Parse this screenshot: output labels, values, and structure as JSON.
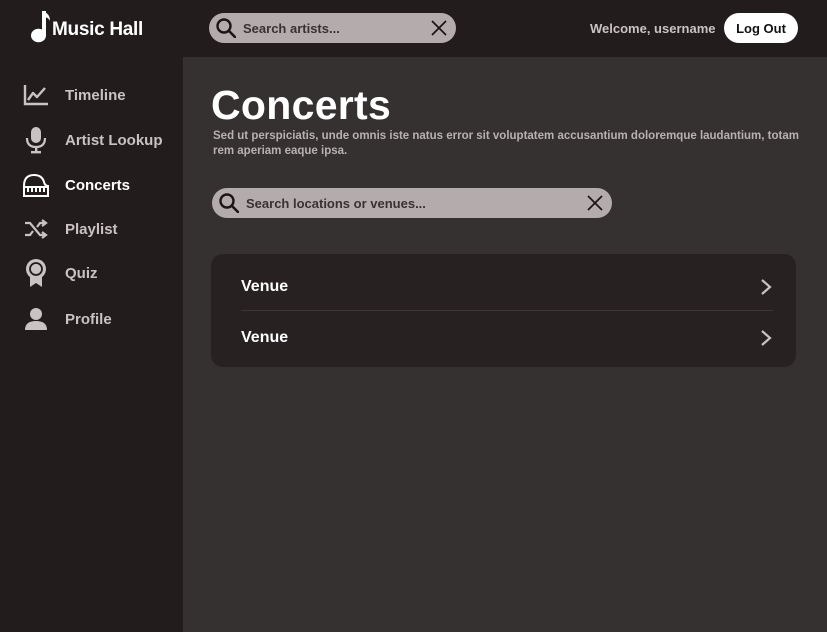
{
  "app": {
    "name": "Music Hall",
    "icon": "music-note-icon"
  },
  "sidebar": {
    "items": [
      {
        "label": "Timeline",
        "icon": "chart-line-icon",
        "active": false
      },
      {
        "label": "Artist Lookup",
        "icon": "microphone-icon",
        "active": false
      },
      {
        "label": "Concerts",
        "icon": "piano-icon",
        "active": true
      },
      {
        "label": "Playlist",
        "icon": "shuffle-icon",
        "active": false
      },
      {
        "label": "Quiz",
        "icon": "award-icon",
        "active": false
      },
      {
        "label": "Profile",
        "icon": "user-icon",
        "active": false
      }
    ]
  },
  "header": {
    "search": {
      "placeholder": "Search artists...",
      "value": ""
    },
    "welcome": "Welcome, username",
    "logout_label": "Log Out"
  },
  "main": {
    "title": "Concerts",
    "description": "Sed ut perspiciatis, unde omnis iste natus error sit voluptatem accusantium doloremque laudantium, totam rem aperiam eaque ipsa.",
    "search": {
      "placeholder": "Search locations or venues...",
      "value": ""
    },
    "venues": [
      {
        "label": "Venue"
      },
      {
        "label": "Venue"
      }
    ]
  },
  "colors": {
    "sidebar_bg": "#231c1d",
    "main_bg": "#353131",
    "card_bg": "#272122",
    "search_bg": "#b4acac",
    "text_primary": "#ffffff",
    "text_muted": "#c9c3c3"
  }
}
